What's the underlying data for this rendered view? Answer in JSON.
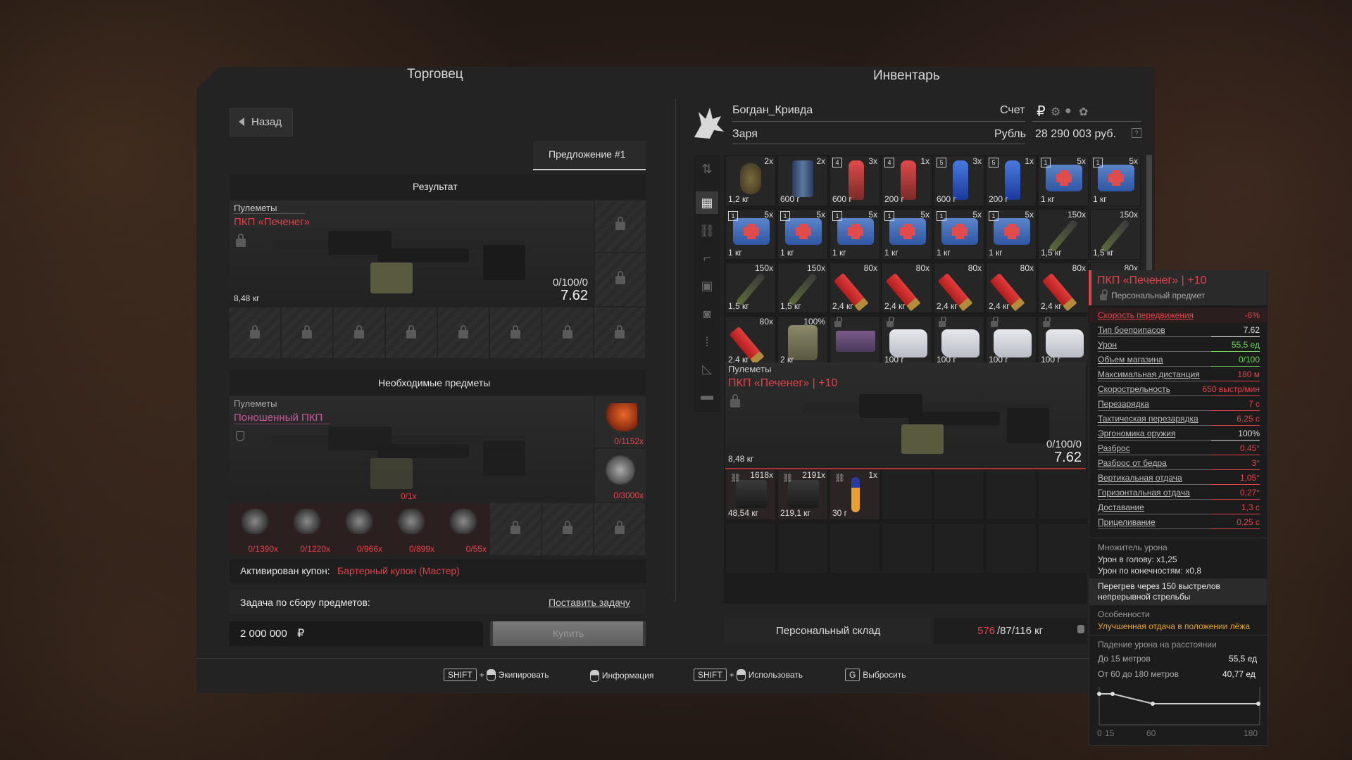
{
  "trader": {
    "header": "Торговец",
    "back_label": "Назад",
    "offer_tab": "Предложение #1",
    "result_title": "Результат",
    "result_item": {
      "category": "Пулеметы",
      "name": "ПКП «Печенег»",
      "weight": "8,48 кг",
      "durability": "0/100/0",
      "caliber": "7.62"
    },
    "required_title": "Необходимые предметы",
    "required_item": {
      "category": "Пулеметы",
      "name": "Поношенный ПКП",
      "count": "0/1x"
    },
    "side_materials": [
      {
        "count": "0/1152x"
      },
      {
        "count": "0/3000x"
      }
    ],
    "materials": [
      {
        "count": "0/1390x"
      },
      {
        "count": "0/1220x"
      },
      {
        "count": "0/966x"
      },
      {
        "count": "0/899x"
      },
      {
        "count": "0/55x"
      }
    ],
    "coupon_label": "Активирован купон:",
    "coupon_value": "Бартерный купон (Мастер)",
    "task_label": "Задача по сбору предметов:",
    "task_link": "Поставить задачу",
    "price": "2 000 000",
    "currency_symbol": "₽",
    "buy_label": "Купить"
  },
  "inventory": {
    "header": "Инвентарь",
    "player_name": "Богдан_Кривда",
    "faction": "Заря",
    "account_label": "Счет",
    "currency_label": "Рубль",
    "balance": "28 290 003 руб.",
    "items_row1": [
      {
        "count": "2x",
        "weight": "1,2 кг",
        "icon": "grenade-icon"
      },
      {
        "count": "2x",
        "weight": "600 г",
        "icon": "can-icon"
      },
      {
        "count": "3x",
        "weight": "600 г",
        "icon": "bottle-icon",
        "level": "4"
      },
      {
        "count": "1x",
        "weight": "200 г",
        "icon": "bottle-icon",
        "level": "4"
      },
      {
        "count": "3x",
        "weight": "600 г",
        "icon": "bottle-icon",
        "level": "5"
      },
      {
        "count": "1x",
        "weight": "200 г",
        "icon": "bottle-icon",
        "level": "5"
      },
      {
        "count": "5x",
        "weight": "1 кг",
        "icon": "medkit-icon",
        "level": "1"
      },
      {
        "count": "5x",
        "weight": "1 кг",
        "icon": "medkit-icon",
        "level": "1"
      }
    ],
    "items_row2": [
      {
        "count": "5x",
        "weight": "1 кг",
        "icon": "medkit-icon",
        "level": "1"
      },
      {
        "count": "5x",
        "weight": "1 кг",
        "icon": "medkit-icon",
        "level": "1"
      },
      {
        "count": "5x",
        "weight": "1 кг",
        "icon": "medkit-icon",
        "level": "1"
      },
      {
        "count": "5x",
        "weight": "1 кг",
        "icon": "medkit-icon",
        "level": "1"
      },
      {
        "count": "5x",
        "weight": "1 кг",
        "icon": "medkit-icon",
        "level": "1"
      },
      {
        "count": "5x",
        "weight": "1 кг",
        "icon": "medkit-icon",
        "level": "1"
      },
      {
        "count": "150x",
        "weight": "1,5 кг",
        "icon": "rifle-round-icon"
      },
      {
        "count": "150x",
        "weight": "1,5 кг",
        "icon": "rifle-round-icon"
      }
    ],
    "items_row3": [
      {
        "count": "150x",
        "weight": "1,5 кг",
        "icon": "rifle-round-icon"
      },
      {
        "count": "150x",
        "weight": "1,5 кг",
        "icon": "rifle-round-icon"
      },
      {
        "count": "80x",
        "weight": "2,4 кг",
        "icon": "shotgun-shell-icon"
      },
      {
        "count": "80x",
        "weight": "2,4 кг",
        "icon": "shotgun-shell-icon"
      },
      {
        "count": "80x",
        "weight": "2,4 кг",
        "icon": "shotgun-shell-icon"
      },
      {
        "count": "80x",
        "weight": "2,4 кг",
        "icon": "shotgun-shell-icon"
      },
      {
        "count": "80x",
        "weight": "2,4 кг",
        "icon": "shotgun-shell-icon"
      },
      {
        "count": "80x",
        "weight": "",
        "icon": "shotgun-shell-icon"
      }
    ],
    "items_row4": [
      {
        "count": "80x",
        "weight": "2,4 кг",
        "icon": "shotgun-shell-icon"
      },
      {
        "count": "100%",
        "weight": "2 кг",
        "icon": "jerrycan-icon"
      },
      {
        "count": "",
        "weight": "",
        "icon": "cassette-icon"
      },
      {
        "count": "",
        "weight": "100 г",
        "icon": "bag-icon"
      },
      {
        "count": "",
        "weight": "100 г",
        "icon": "bag-icon"
      },
      {
        "count": "",
        "weight": "100 г",
        "icon": "bag-icon"
      },
      {
        "count": "",
        "weight": "100 г",
        "icon": "bag-icon"
      }
    ],
    "weapon": {
      "category": "Пулеметы",
      "name": "ПКП «Печенег» | +10",
      "weight": "8,48 кг",
      "durability": "0/100/0",
      "caliber": "7.62"
    },
    "small_items": [
      {
        "count": "1618x",
        "weight": "48,54 кг",
        "icon": "scrap-icon"
      },
      {
        "count": "2191x",
        "weight": "219,1 кг",
        "icon": "part-icon"
      },
      {
        "count": "1x",
        "weight": "30 г",
        "icon": "round-icon"
      }
    ],
    "stash_label": "Персональный склад",
    "weight_current": "576",
    "weight_rest": "/87/116 кг"
  },
  "tooltip": {
    "title": "ПКП «Печенег» | +10",
    "subtitle": "Персональный предмет",
    "stats": [
      {
        "name": "Скорость передвижения",
        "value": "-6%",
        "color": "#e2434b"
      },
      {
        "name": "Тип боеприпасов",
        "value": "7.62",
        "color": "#dddddd"
      },
      {
        "name": "Урон",
        "value": "55,5 ед",
        "color": "#6fd35a"
      },
      {
        "name": "Объем магазина",
        "value": "0/100",
        "color": "#6fd35a"
      },
      {
        "name": "Максимальная дистанция",
        "value": "180 м",
        "color": "#e2434b"
      },
      {
        "name": "Скорострельность",
        "value": "650 выстр/мин",
        "color": "#e2434b"
      },
      {
        "name": "Перезарядка",
        "value": "7 с",
        "color": "#e2434b"
      },
      {
        "name": "Тактическая перезарядка",
        "value": "6,25 с",
        "color": "#e2434b"
      },
      {
        "name": "Эргономика оружия",
        "value": "100%",
        "color": "#dddddd"
      },
      {
        "name": "Разброс",
        "value": "0,45°",
        "color": "#e2434b"
      },
      {
        "name": "Разброс от бедра",
        "value": "3°",
        "color": "#e2434b"
      },
      {
        "name": "Вертикальная отдача",
        "value": "1,05°",
        "color": "#e2434b"
      },
      {
        "name": "Горизонтальная отдача",
        "value": "0,27°",
        "color": "#e2434b"
      },
      {
        "name": "Доставание",
        "value": "1,3 с",
        "color": "#e2434b"
      },
      {
        "name": "Прицеливание",
        "value": "0,25 с",
        "color": "#e2434b"
      }
    ],
    "multiplier_title": "Множитель урона",
    "head_mult": "Урон в голову: х1,25",
    "limbs_mult": "Урон по конечностям: х0,8",
    "overheat": "Перегрев через 150 выстрелов непрерывной стрельбы",
    "features_title": "Особенности",
    "feature": "Улучшенная отдача в положении лёжа",
    "falloff_title": "Падение урона на расстоянии",
    "falloff": [
      {
        "label": "До 15 метров",
        "value": "55,5 ед"
      },
      {
        "label": "От 60 до 180 метров",
        "value": "40,77 ед"
      }
    ],
    "graph_ticks": [
      "0",
      "15",
      "60",
      "180"
    ]
  },
  "hints": [
    {
      "key": "SHIFT",
      "label": "Экипировать"
    },
    {
      "key": "",
      "label": "Информация"
    },
    {
      "key": "SHIFT",
      "label": "Использовать"
    },
    {
      "key": "G",
      "label": "Выбросить"
    }
  ],
  "colors": {
    "accent_red": "#e2434b",
    "accent_pink": "#c45a9b",
    "positive": "#6fd35a"
  }
}
